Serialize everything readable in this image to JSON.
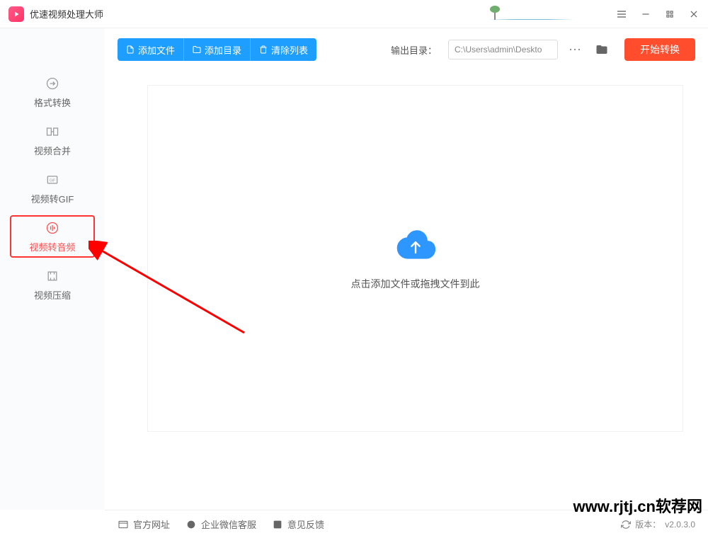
{
  "app": {
    "title": "优速视频处理大师"
  },
  "sidebar": {
    "items": [
      {
        "label": "格式转换"
      },
      {
        "label": "视频合并"
      },
      {
        "label": "视频转GIF"
      },
      {
        "label": "视频转音频"
      },
      {
        "label": "视频压缩"
      }
    ]
  },
  "toolbar": {
    "add_file": "添加文件",
    "add_folder": "添加目录",
    "clear_list": "清除列表",
    "output_label": "输出目录：",
    "output_path": "C:\\Users\\admin\\Deskto",
    "start": "开始转换"
  },
  "dropzone": {
    "hint": "点击添加文件或拖拽文件到此"
  },
  "footer": {
    "official_site": "官方网址",
    "enterprise_wechat": "企业微信客服",
    "feedback": "意见反馈",
    "version_label": "版本：",
    "version_value": "v2.0.3.0"
  },
  "watermark": "www.rjtj.cn软荐网"
}
